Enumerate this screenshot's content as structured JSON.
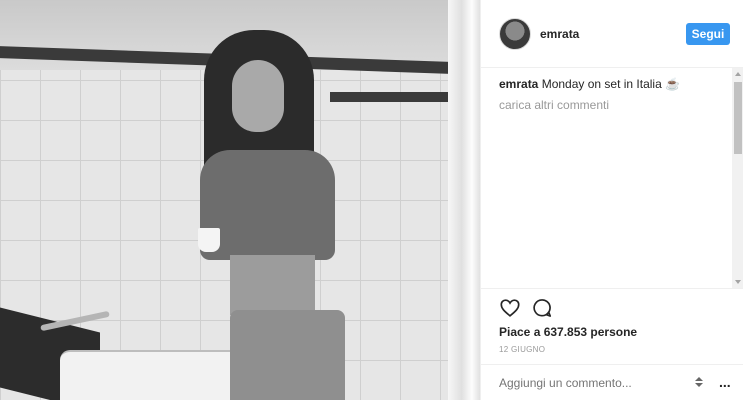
{
  "post": {
    "username": "emrata",
    "follow_label": "Segui",
    "caption_user": "emrata",
    "caption_text": "Monday on set in Italia ☕",
    "load_more_label": "carica altri commenti",
    "likes_text": "Piace a 637.853 persone",
    "date_text": "12 GIUGNO",
    "add_comment_placeholder": "Aggiungi un commento...",
    "more_options_label": "..."
  },
  "icons": {
    "heart": "heart-icon",
    "comment": "comment-icon"
  },
  "colors": {
    "follow_button": "#3897f0",
    "muted_text": "#999999",
    "text": "#262626"
  }
}
